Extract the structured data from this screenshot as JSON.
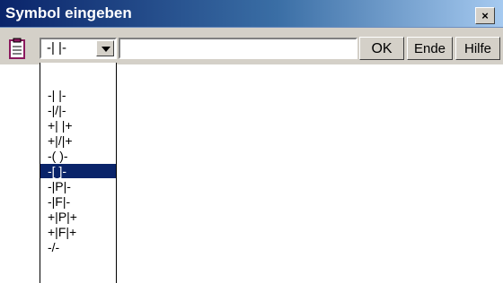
{
  "window": {
    "title": "Symbol eingeben",
    "close_label": "×"
  },
  "toolbar": {
    "clipboard_icon": "clipboard-icon",
    "combo_value": "-| |-",
    "input_value": "",
    "ok_label": "OK",
    "ende_label": "Ende",
    "hilfe_label": "Hilfe"
  },
  "dropdown": {
    "items": [
      "-| |-",
      "-|/|-",
      "+| |+",
      "+|/|+",
      "-( )-",
      "-[ ]-",
      "-|P|-",
      "-|F|-",
      "+|P|+",
      "+|F|+",
      "-/-"
    ],
    "selected_index": 5
  },
  "colors": {
    "title_bar": "#0a246a",
    "selection": "#0a246a",
    "face": "#d4d0c8"
  }
}
